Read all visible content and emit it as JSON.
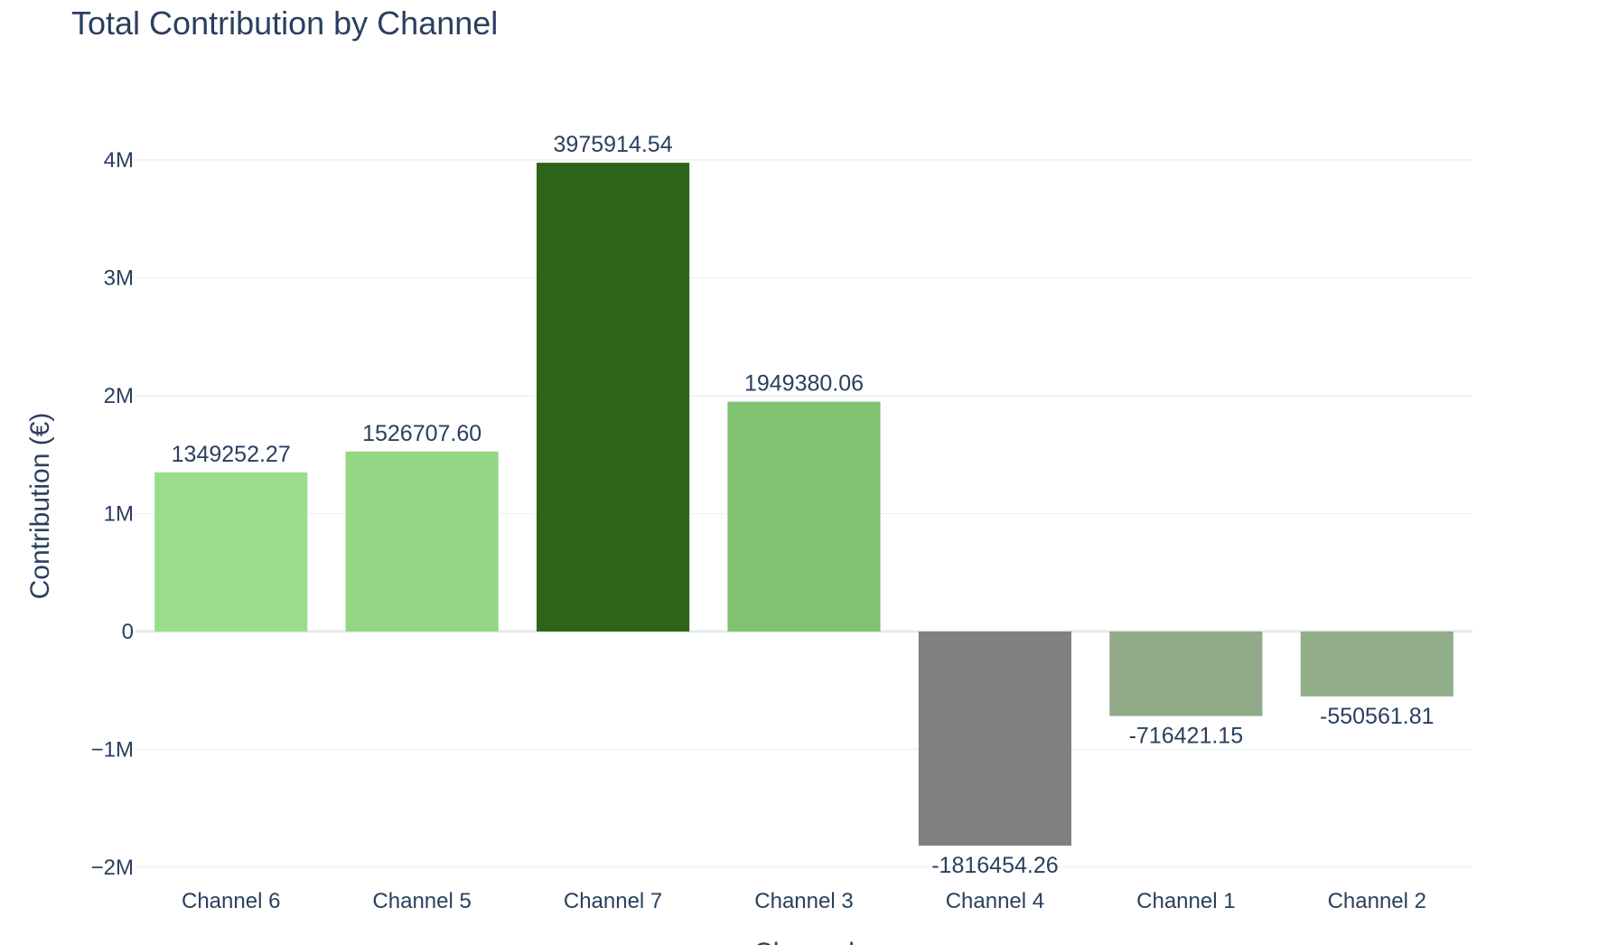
{
  "chart_data": {
    "type": "bar",
    "title": "Total Contribution by Channel",
    "xlabel": "Channel",
    "ylabel": "Contribution (€)",
    "categories": [
      "Channel 6",
      "Channel 5",
      "Channel 7",
      "Channel 3",
      "Channel 4",
      "Channel 1",
      "Channel 2"
    ],
    "values": [
      1349252.27,
      1526707.6,
      3975914.54,
      1949380.06,
      -1816454.26,
      -716421.15,
      -550561.81
    ],
    "value_labels": [
      "1349252.27",
      "1526707.60",
      "3975914.54",
      "1949380.06",
      "-1816454.26",
      "-716421.15",
      "-550561.81"
    ],
    "colors": [
      "#9ade8c",
      "#93d784",
      "#2d6419",
      "#7fc370",
      "#808080",
      "#91aa88",
      "#91ae88"
    ],
    "yticks": [
      {
        "value": 4000000,
        "label": "4M"
      },
      {
        "value": 3000000,
        "label": "3M"
      },
      {
        "value": 2000000,
        "label": "2M"
      },
      {
        "value": 1000000,
        "label": "1M"
      },
      {
        "value": 0,
        "label": "0"
      },
      {
        "value": -1000000,
        "label": "−1M"
      },
      {
        "value": -2000000,
        "label": "−2M"
      }
    ],
    "ylim": [
      -2000000,
      4000000
    ],
    "grid": true,
    "legend": "none"
  }
}
